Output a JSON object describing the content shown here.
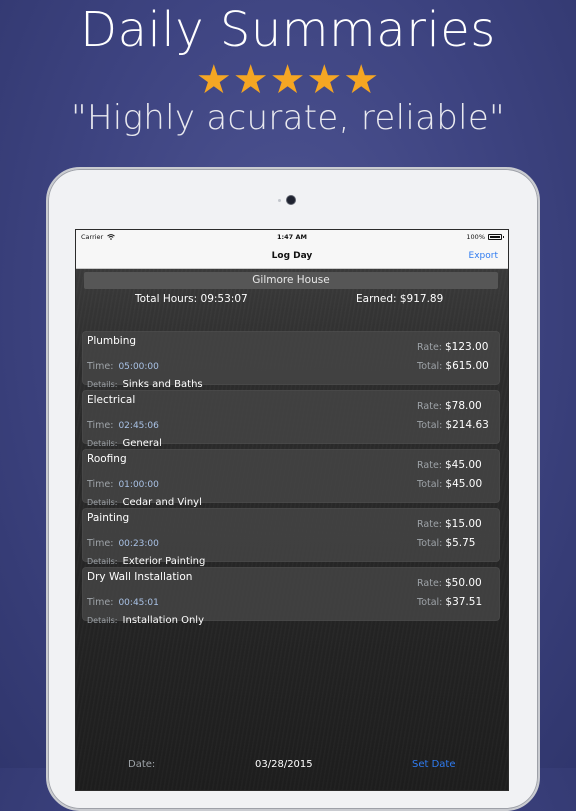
{
  "promo": {
    "headline": "Daily Summaries",
    "stars": "★★★★★",
    "quote": "\"Highly acurate, reliable\""
  },
  "status_bar": {
    "carrier": "Carrier",
    "time": "1:47 AM",
    "battery": "100%"
  },
  "nav": {
    "title": "Log Day",
    "export_label": "Export"
  },
  "job": {
    "name": "Gilmore House",
    "total_hours_label": "Total Hours:",
    "total_hours": "09:53:07",
    "earned_label": "Earned:",
    "earned": "$917.89"
  },
  "labels": {
    "time": "Time:",
    "details": "Details:",
    "rate": "Rate:",
    "total": "Total:"
  },
  "entries": [
    {
      "name": "Plumbing",
      "time": "05:00:00",
      "details": "Sinks and Baths",
      "rate": "$123.00",
      "total": "$615.00"
    },
    {
      "name": "Electrical",
      "time": "02:45:06",
      "details": "General",
      "rate": "$78.00",
      "total": "$214.63"
    },
    {
      "name": "Roofing",
      "time": "01:00:00",
      "details": "Cedar and Vinyl",
      "rate": "$45.00",
      "total": "$45.00"
    },
    {
      "name": "Painting",
      "time": "00:23:00",
      "details": "Exterior Painting",
      "rate": "$15.00",
      "total": "$5.75"
    },
    {
      "name": "Dry Wall Installation",
      "time": "00:45:01",
      "details": "Installation Only",
      "rate": "$50.00",
      "total": "$37.51"
    }
  ],
  "footer": {
    "date_label": "Date:",
    "date_value": "03/28/2015",
    "set_date_label": "Set Date"
  },
  "colors": {
    "background": "#3d4380",
    "stars": "#f5a623",
    "link_blue": "#2f7bf0",
    "time_value": "#a9c2e6"
  },
  "icons": {
    "wifi": "wifi-icon",
    "battery": "battery-icon",
    "camera": "camera-icon"
  }
}
